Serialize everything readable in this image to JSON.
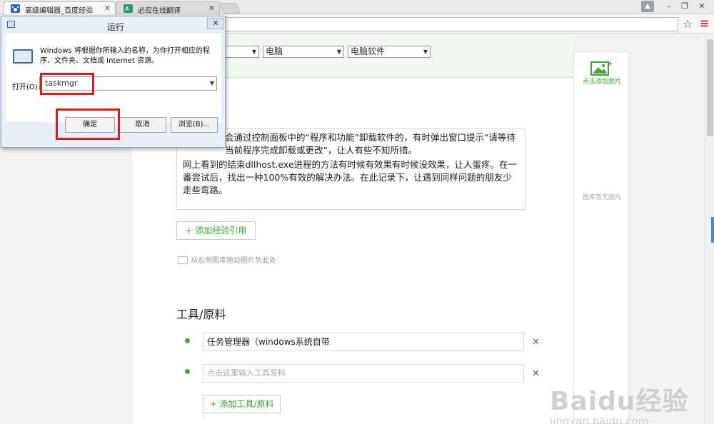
{
  "browser": {
    "tabs": [
      {
        "title": "高级编辑器_百度经验",
        "active": true
      },
      {
        "title": "必应在线翻译",
        "active": false
      }
    ],
    "window_controls": [
      "▲",
      "–",
      "❐",
      "✕"
    ]
  },
  "run_dialog": {
    "title": "运行",
    "message": "Windows 将根据你所输入的名称，为你打开相应的程序、文件夹、文档或 Internet 资源。",
    "open_label": "打开(O):",
    "input_value": "taskmgr",
    "buttons": {
      "ok": "确定",
      "cancel": "取消",
      "browse": "浏览(B)..."
    }
  },
  "editor": {
    "categories": [
      "",
      "电脑",
      "电脑软件"
    ],
    "intro_paragraphs": [
      "会通过控制面板中的“程序和功能”卸载软件的，有时弹出窗口提示“请等待当前程序完成卸载或更改”，让人有些不知所措。",
      "网上看到的结束dllhost.exe进程的方法有时候有效果有时候没效果，让人蛋疼。在一番尝试后，找出一种100%有效的解决办法。在此记录下，让遇到同样问题的朋友少走些弯路。"
    ],
    "add_reference": "+ 添加经验引用",
    "drag_hint": "从右侧图库拖动图片到此处",
    "tools_title": "工具/原料",
    "tools": [
      {
        "value": "任务管理器（windows系统自带",
        "placeholder": ""
      },
      {
        "value": "",
        "placeholder": "点击这里输入工具原料"
      }
    ],
    "add_tool": "+ 添加工具/原料"
  },
  "side_panel": {
    "add_image": "点击添加图片",
    "empty": "图库暂无图片"
  },
  "watermark": {
    "logo": "Baidu经验",
    "url": "jingyan.baidu.com"
  },
  "colors": {
    "accent_green": "#3fa935",
    "highlight_red": "#e0191e"
  }
}
